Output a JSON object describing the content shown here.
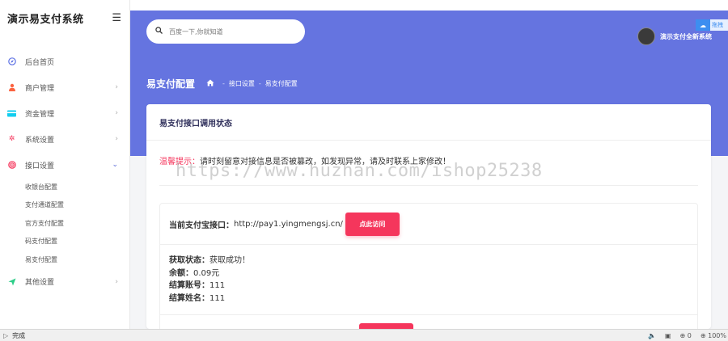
{
  "app": {
    "title": "演示易支付系统",
    "menu_toggle_icon": "menu-icon"
  },
  "sidebar": {
    "items": [
      {
        "label": "后台首页",
        "icon": "compass-icon",
        "color": "#5e72e4",
        "has_chevron": false
      },
      {
        "label": "商户管理",
        "icon": "user-icon",
        "color": "#fb6340",
        "has_chevron": true
      },
      {
        "label": "资金管理",
        "icon": "card-icon",
        "color": "#11cdef",
        "has_chevron": true
      },
      {
        "label": "系统设置",
        "icon": "gear-icon",
        "color": "#f5365c",
        "has_chevron": true
      },
      {
        "label": "接口设置",
        "icon": "target-icon",
        "color": "#f5365c",
        "has_chevron": true,
        "open": true
      },
      {
        "label": "其他设置",
        "icon": "send-icon",
        "color": "#2dce89",
        "has_chevron": true
      }
    ],
    "subitems": [
      "收银台配置",
      "支付通道配置",
      "官方支付配置",
      "码支付配置",
      "易支付配置"
    ]
  },
  "header": {
    "search_placeholder": "百度一下,你就知道",
    "user_name": "演示支付全新系统",
    "corner_badge_text": "拖拽"
  },
  "page": {
    "title": "易支付配置",
    "breadcrumb": [
      "接口设置",
      "易支付配置"
    ]
  },
  "card": {
    "title": "易支付接口调用状态",
    "notice_warn": "温馨提示：",
    "notice_text": "请时刻留意对接信息是否被篡改，如发现异常，请及时联系上家修改！",
    "watermark": "https://www.huzhan.com/ishop25238",
    "interface_label": "当前支付宝接口：",
    "interface_url": "http://pay1.yingmengsj.cn/",
    "visit_button": "点此访问",
    "status_rows": [
      {
        "key": "获取状态：",
        "value": "获取成功！"
      },
      {
        "key": "余额：",
        "value": "0.09元"
      },
      {
        "key": "结算账号：",
        "value": "111"
      },
      {
        "key": "结算姓名：",
        "value": "111"
      }
    ]
  },
  "statusbar": {
    "status": "完成",
    "counter": "0",
    "zoom": "100%"
  },
  "colors": {
    "accent": "#6574e0",
    "danger": "#f5365c"
  }
}
